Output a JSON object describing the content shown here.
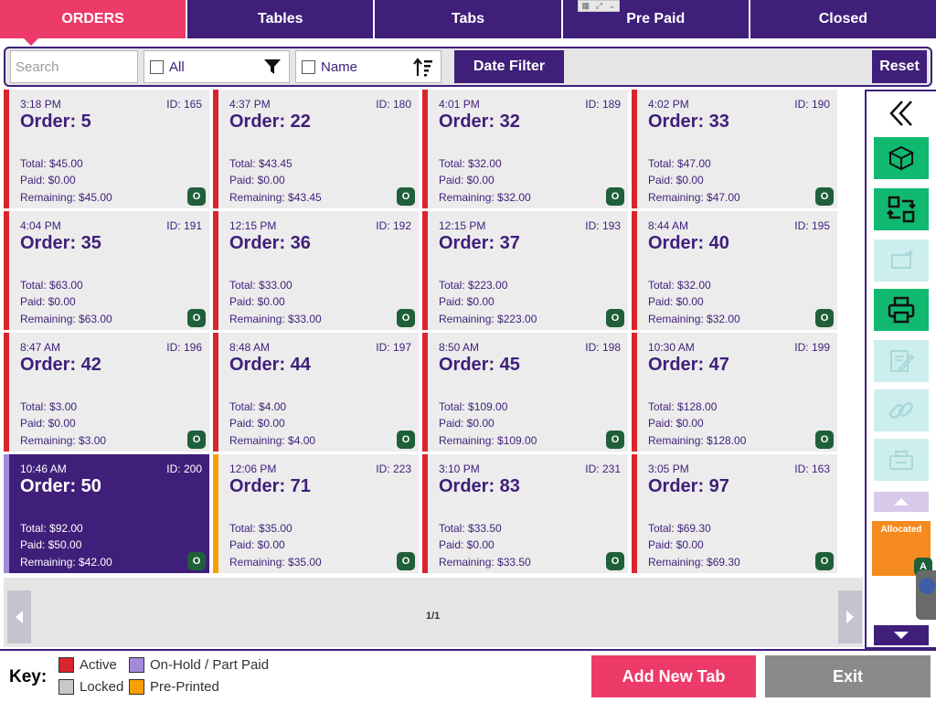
{
  "tabs": [
    {
      "label": "ORDERS",
      "active": true
    },
    {
      "label": "Tables",
      "active": false
    },
    {
      "label": "Tabs",
      "active": false
    },
    {
      "label": "Pre Paid",
      "active": false
    },
    {
      "label": "Closed",
      "active": false
    }
  ],
  "filter": {
    "search_placeholder": "Search",
    "all_label": "All",
    "name_label": "Name",
    "date_filter_label": "Date Filter",
    "reset_label": "Reset"
  },
  "orders": [
    {
      "time": "3:18 PM",
      "id": "ID:  165",
      "order": "Order: 5",
      "total": "Total: $45.00",
      "paid": "Paid: $0.00",
      "remaining": "Remaining: $45.00",
      "badge": "O",
      "status": "active"
    },
    {
      "time": "4:37 PM",
      "id": "ID:  180",
      "order": "Order: 22",
      "total": "Total: $43.45",
      "paid": "Paid: $0.00",
      "remaining": "Remaining: $43.45",
      "badge": "O",
      "status": "active"
    },
    {
      "time": "4:01 PM",
      "id": "ID:  189",
      "order": "Order: 32",
      "total": "Total: $32.00",
      "paid": "Paid: $0.00",
      "remaining": "Remaining: $32.00",
      "badge": "O",
      "status": "active"
    },
    {
      "time": "4:02 PM",
      "id": "ID:  190",
      "order": "Order: 33",
      "total": "Total: $47.00",
      "paid": "Paid: $0.00",
      "remaining": "Remaining: $47.00",
      "badge": "O",
      "status": "active"
    },
    {
      "time": "4:04 PM",
      "id": "ID:  191",
      "order": "Order: 35",
      "total": "Total: $63.00",
      "paid": "Paid: $0.00",
      "remaining": "Remaining: $63.00",
      "badge": "O",
      "status": "active"
    },
    {
      "time": "12:15 PM",
      "id": "ID:  192",
      "order": "Order: 36",
      "total": "Total: $33.00",
      "paid": "Paid: $0.00",
      "remaining": "Remaining: $33.00",
      "badge": "O",
      "status": "active"
    },
    {
      "time": "12:15 PM",
      "id": "ID:  193",
      "order": "Order: 37",
      "total": "Total: $223.00",
      "paid": "Paid: $0.00",
      "remaining": "Remaining: $223.00",
      "badge": "O",
      "status": "active"
    },
    {
      "time": "8:44 AM",
      "id": "ID:  195",
      "order": "Order: 40",
      "total": "Total: $32.00",
      "paid": "Paid: $0.00",
      "remaining": "Remaining: $32.00",
      "badge": "O",
      "status": "active"
    },
    {
      "time": "8:47 AM",
      "id": "ID:  196",
      "order": "Order: 42",
      "total": "Total: $3.00",
      "paid": "Paid: $0.00",
      "remaining": "Remaining: $3.00",
      "badge": "O",
      "status": "active"
    },
    {
      "time": "8:48 AM",
      "id": "ID:  197",
      "order": "Order: 44",
      "total": "Total: $4.00",
      "paid": "Paid: $0.00",
      "remaining": "Remaining: $4.00",
      "badge": "O",
      "status": "active"
    },
    {
      "time": "8:50 AM",
      "id": "ID:  198",
      "order": "Order: 45",
      "total": "Total: $109.00",
      "paid": "Paid: $0.00",
      "remaining": "Remaining: $109.00",
      "badge": "O",
      "status": "active"
    },
    {
      "time": "10:30 AM",
      "id": "ID:  199",
      "order": "Order: 47",
      "total": "Total: $128.00",
      "paid": "Paid: $0.00",
      "remaining": "Remaining: $128.00",
      "badge": "O",
      "status": "active"
    },
    {
      "time": "10:46 AM",
      "id": "ID:  200",
      "order": "Order: 50",
      "total": "Total: $92.00",
      "paid": "Paid: $50.00",
      "remaining": "Remaining: $42.00",
      "badge": "O",
      "status": "hold"
    },
    {
      "time": "12:06 PM",
      "id": "ID:  223",
      "order": "Order: 71",
      "total": "Total: $35.00",
      "paid": "Paid: $0.00",
      "remaining": "Remaining: $35.00",
      "badge": "O",
      "status": "preprinted"
    },
    {
      "time": "3:10 PM",
      "id": "ID:  231",
      "order": "Order: 83",
      "total": "Total: $33.50",
      "paid": "Paid: $0.00",
      "remaining": "Remaining: $33.50",
      "badge": "O",
      "status": "active"
    },
    {
      "time": "3:05 PM",
      "id": "ID:  163",
      "order": "Order: 97",
      "total": "Total: $69.30",
      "paid": "Paid: $0.00",
      "remaining": "Remaining: $69.30",
      "badge": "O",
      "status": "active"
    }
  ],
  "pagination": {
    "label": "1/1"
  },
  "sidebar": {
    "allocated_label": "Allocated",
    "allocated_badge": "A"
  },
  "footer": {
    "key_label": "Key:",
    "legend": [
      {
        "label": "Active",
        "color": "#d9252d"
      },
      {
        "label": "On-Hold / Part Paid",
        "color": "#a48ad8"
      },
      {
        "label": "Locked",
        "color": "#c8c8c8"
      },
      {
        "label": "Pre-Printed",
        "color": "#f5a000"
      }
    ],
    "add_tab_label": "Add New Tab",
    "exit_label": "Exit"
  },
  "colors": {
    "brand_purple": "#3f1f7a",
    "accent_pink": "#ec3a69",
    "tool_green": "#10b870",
    "allocated_orange": "#f58a1f"
  }
}
